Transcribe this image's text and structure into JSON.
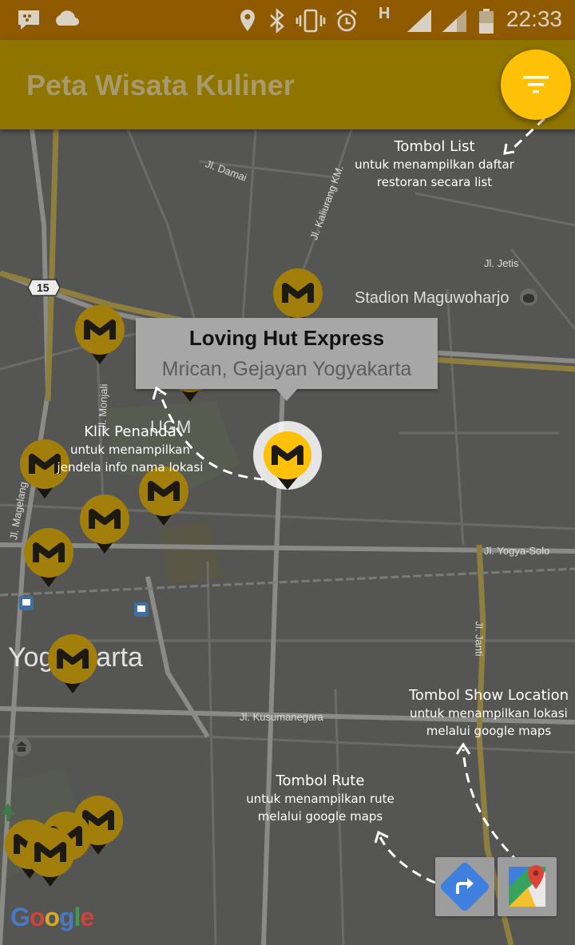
{
  "status_bar": {
    "time": "22:33",
    "network_letter": "H",
    "icons": [
      "bbm-icon",
      "cloud-icon",
      "location-icon",
      "bluetooth-icon",
      "vibrate-icon",
      "alarm-icon",
      "signal-icon",
      "battery-icon"
    ]
  },
  "app_bar": {
    "title": "Peta Wisata Kuliner",
    "filter_icon": "filter-list-icon",
    "accent_color": "#ffc107",
    "bar_color": "#8f7400"
  },
  "map": {
    "road_labels": {
      "damai": "Jl. Damai",
      "kaliurang": "Jl. Kaliurang KM.",
      "jetis": "Jl. Jetis",
      "yogya_solo": "Jl. Yogya-Solo",
      "janti": "Jl. Janti",
      "kusumanegara": "Jl. Kusumanegara",
      "magelang": "Jl. Magelang",
      "monjali": "Jl. Monjali",
      "route_number": "15"
    },
    "place_labels": {
      "stadion": "Stadion Maguwoharjo",
      "ugm": "UGM",
      "city": "Yogyakarta"
    },
    "google_logo": "Google"
  },
  "info_window": {
    "title": "Loving Hut Express",
    "subtitle": "Mrican, Gejayan Yogyakarta"
  },
  "annotations": {
    "list_button": {
      "title": "Tombol List",
      "line1": "untuk menampilkan daftar",
      "line2": "restoran secara list"
    },
    "marker": {
      "title": "Klik Penanda",
      "line1": "untuk menampilkan",
      "line2": "jendela info nama lokasi"
    },
    "show_location": {
      "title": "Tombol Show Location",
      "line1": "untuk menampilkan lokasi",
      "line2": "melalui google maps"
    },
    "route": {
      "title": "Tombol Rute",
      "line1": "untuk menampilkan rute",
      "line2": "melalui google maps"
    }
  },
  "map_buttons": {
    "route_icon": "directions-icon",
    "maps_icon": "google-maps-icon"
  }
}
